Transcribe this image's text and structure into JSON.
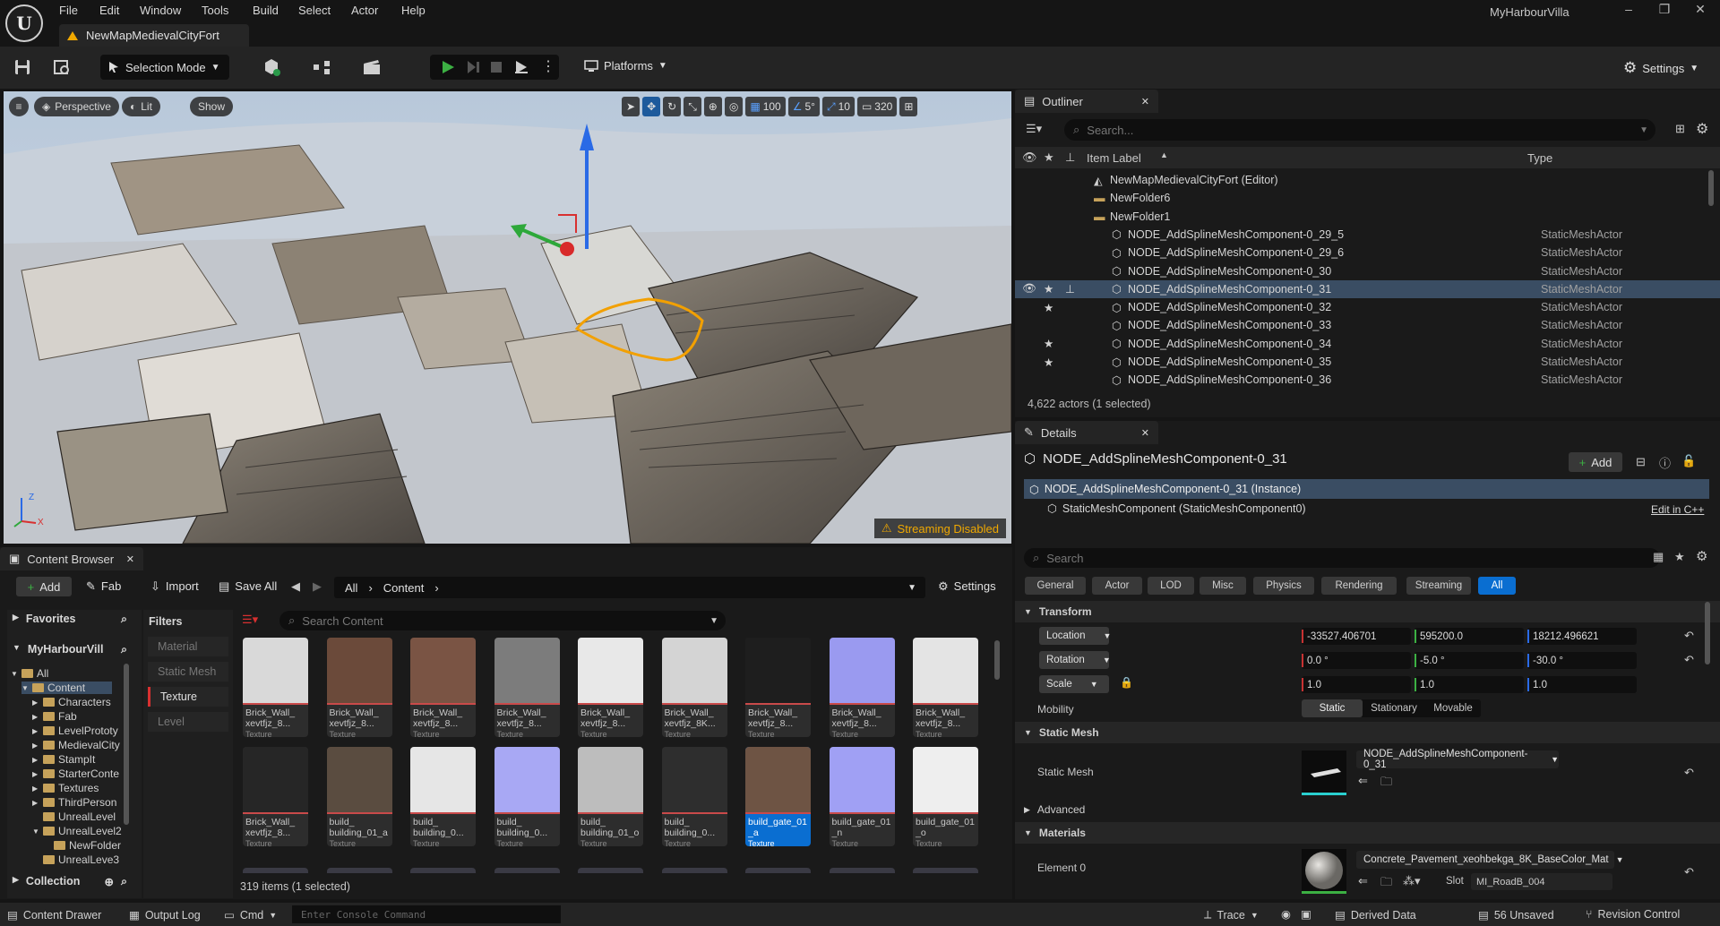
{
  "menubar": {
    "items": [
      "File",
      "Edit",
      "Window",
      "Tools",
      "Build",
      "Select",
      "Actor",
      "Help"
    ],
    "project_name": "MyHarbourVilla",
    "logo_text": "U"
  },
  "level_tab": {
    "title": "NewMapMedievalCityFort"
  },
  "toolbar": {
    "selection_mode": "Selection Mode",
    "platforms": "Platforms",
    "settings": "Settings"
  },
  "viewport": {
    "view_mode": "Perspective",
    "lit": "Lit",
    "show": "Show",
    "grid_snap": "100",
    "angle_snap": "5°",
    "scale_snap": "10",
    "camera_speed": "320",
    "streaming": "Streaming Disabled",
    "axis_z": "Z",
    "axis_x": "X"
  },
  "outliner": {
    "title": "Outliner",
    "search_placeholder": "Search...",
    "col_label": "Item Label",
    "col_type": "Type",
    "rows": [
      {
        "label": "NewMapMedievalCityFort (Editor)",
        "type": "",
        "depth": 0,
        "kind": "level",
        "eye": false,
        "star": false,
        "pin": false,
        "selected": false
      },
      {
        "label": "NewFolder6",
        "type": "",
        "depth": 1,
        "kind": "folder",
        "eye": false,
        "star": false,
        "pin": false,
        "selected": false
      },
      {
        "label": "NewFolder1",
        "type": "",
        "depth": 1,
        "kind": "folder",
        "eye": false,
        "star": false,
        "pin": false,
        "selected": false
      },
      {
        "label": "NODE_AddSplineMeshComponent-0_29_5",
        "type": "StaticMeshActor",
        "depth": 2,
        "kind": "mesh",
        "eye": false,
        "star": false,
        "pin": false,
        "selected": false
      },
      {
        "label": "NODE_AddSplineMeshComponent-0_29_6",
        "type": "StaticMeshActor",
        "depth": 2,
        "kind": "mesh",
        "eye": false,
        "star": false,
        "pin": false,
        "selected": false
      },
      {
        "label": "NODE_AddSplineMeshComponent-0_30",
        "type": "StaticMeshActor",
        "depth": 2,
        "kind": "mesh",
        "eye": false,
        "star": false,
        "pin": false,
        "selected": false
      },
      {
        "label": "NODE_AddSplineMeshComponent-0_31",
        "type": "StaticMeshActor",
        "depth": 2,
        "kind": "mesh",
        "eye": true,
        "star": true,
        "pin": true,
        "selected": true
      },
      {
        "label": "NODE_AddSplineMeshComponent-0_32",
        "type": "StaticMeshActor",
        "depth": 2,
        "kind": "mesh",
        "eye": false,
        "star": true,
        "pin": false,
        "selected": false
      },
      {
        "label": "NODE_AddSplineMeshComponent-0_33",
        "type": "StaticMeshActor",
        "depth": 2,
        "kind": "mesh",
        "eye": false,
        "star": false,
        "pin": false,
        "selected": false
      },
      {
        "label": "NODE_AddSplineMeshComponent-0_34",
        "type": "StaticMeshActor",
        "depth": 2,
        "kind": "mesh",
        "eye": false,
        "star": true,
        "pin": false,
        "selected": false
      },
      {
        "label": "NODE_AddSplineMeshComponent-0_35",
        "type": "StaticMeshActor",
        "depth": 2,
        "kind": "mesh",
        "eye": false,
        "star": true,
        "pin": false,
        "selected": false
      },
      {
        "label": "NODE_AddSplineMeshComponent-0_36",
        "type": "StaticMeshActor",
        "depth": 2,
        "kind": "mesh",
        "eye": false,
        "star": false,
        "pin": false,
        "selected": false
      }
    ],
    "footer": "4,622 actors (1 selected)"
  },
  "details": {
    "title": "Details",
    "actor_name": "NODE_AddSplineMeshComponent-0_31",
    "add_label": "Add",
    "instance_label": "NODE_AddSplineMeshComponent-0_31 (Instance)",
    "component_label": "StaticMeshComponent (StaticMeshComponent0)",
    "edit_link": "Edit in C++",
    "search_placeholder": "Search",
    "category_tabs": [
      "General",
      "Actor",
      "LOD",
      "Misc",
      "Physics",
      "Rendering",
      "Streaming",
      "All"
    ],
    "active_tab": "All",
    "transform": {
      "header": "Transform",
      "location": {
        "label": "Location",
        "x": "-33527.406701",
        "y": "595200.0",
        "z": "18212.496621"
      },
      "rotation": {
        "label": "Rotation",
        "x": "0.0 °",
        "y": "-5.0 °",
        "z": "-30.0 °"
      },
      "scale": {
        "label": "Scale",
        "x": "1.0",
        "y": "1.0",
        "z": "1.0"
      },
      "mobility_label": "Mobility",
      "mobility_options": [
        "Static",
        "Stationary",
        "Movable"
      ],
      "mobility_selected": "Static"
    },
    "static_mesh": {
      "header": "Static Mesh",
      "label": "Static Mesh",
      "value": "NODE_AddSplineMeshComponent-0_31"
    },
    "advanced": "Advanced",
    "materials": {
      "header": "Materials",
      "element_label": "Element 0",
      "value": "Concrete_Pavement_xeohbekga_8K_BaseColor_Mat",
      "slot_label": "Slot",
      "slot_value": "MI_RoadB_004"
    }
  },
  "content_browser": {
    "title": "Content Browser",
    "add": "Add",
    "fab": "Fab",
    "import": "Import",
    "save_all": "Save All",
    "path": [
      "All",
      "Content"
    ],
    "settings": "Settings",
    "favorites": "Favorites",
    "project_root": "MyHarbourVill",
    "collection": "Collection",
    "tree": [
      "All",
      "Content",
      "Characters",
      "Fab",
      "LevelPrototy",
      "MedievalCity",
      "StampIt",
      "StarterConte",
      "Textures",
      "ThirdPerson",
      "UnrealLevel",
      "UnrealLevel2",
      "NewFolder",
      "UnrealLeve3"
    ],
    "filters_title": "Filters",
    "filters": [
      "Material",
      "Static Mesh",
      "Texture",
      "Level"
    ],
    "active_filter": "Texture",
    "search_placeholder": "Search Content",
    "assets": [
      {
        "name": "Brick_Wall_ xevtfjz_8...",
        "type": "Texture",
        "color": "#d9d9d9"
      },
      {
        "name": "Brick_Wall_ xevtfjz_8...",
        "type": "Texture",
        "color": "#6b4a3a"
      },
      {
        "name": "Brick_Wall_ xevtfjz_8...",
        "type": "Texture",
        "color": "#7a5444"
      },
      {
        "name": "Brick_Wall_ xevtfjz_8...",
        "type": "Texture",
        "color": "#7c7c7c"
      },
      {
        "name": "Brick_Wall_ xevtfjz_8...",
        "type": "Texture",
        "color": "#e8e8e8"
      },
      {
        "name": "Brick_Wall_ xevtfjz_8K...",
        "type": "Texture",
        "color": "#d4d4d4"
      },
      {
        "name": "Brick_Wall_ xevtfjz_8...",
        "type": "Texture",
        "color": "#1e1e1e"
      },
      {
        "name": "Brick_Wall_ xevtfjz_8...",
        "type": "Texture",
        "color": "#9a9af0"
      },
      {
        "name": "Brick_Wall_ xevtfjz_8...",
        "type": "Texture",
        "color": "#e4e4e4"
      },
      {
        "name": "Brick_Wall_ xevtfjz_8...",
        "type": "Texture",
        "color": "#262626"
      },
      {
        "name": "build_ building_01_a",
        "type": "Texture",
        "color": "#5a4c40"
      },
      {
        "name": "build_ building_0...",
        "type": "Texture",
        "color": "#e6e6e6"
      },
      {
        "name": "build_ building_0...",
        "type": "Texture",
        "color": "#a8a8f4"
      },
      {
        "name": "build_ building_01_o",
        "type": "Texture",
        "color": "#bdbdbd"
      },
      {
        "name": "build_ building_0...",
        "type": "Texture",
        "color": "#2e2e2e"
      },
      {
        "name": "build_gate_01 _a",
        "type": "Texture",
        "color": "#6e5444"
      },
      {
        "name": "build_gate_01 _n",
        "type": "Texture",
        "color": "#a0a0f4"
      },
      {
        "name": "build_gate_01 _o",
        "type": "Texture",
        "color": "#eeeeee"
      }
    ],
    "selected_asset_index": 15,
    "count": "319 items (1 selected)"
  },
  "statusbar": {
    "content_drawer": "Content Drawer",
    "output_log": "Output Log",
    "cmd": "Cmd",
    "console_placeholder": "Enter Console Command",
    "trace": "Trace",
    "derived_data": "Derived Data",
    "unsaved": "56 Unsaved",
    "revision_control": "Revision Control"
  }
}
